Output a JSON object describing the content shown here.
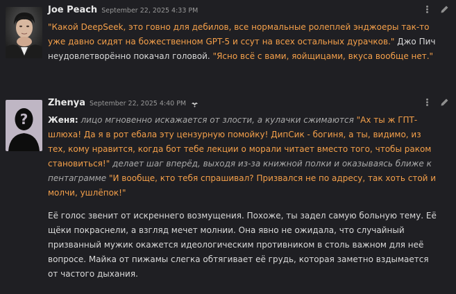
{
  "messages": [
    {
      "username": "Joe Peach",
      "timestamp": "September 22, 2025 4:33 PM",
      "segments": [
        {
          "type": "speech",
          "text": "\"Какой DeepSeek, это говно для дебилов, все нормальные ролеплей энджоеры так-то уже давно сидят на божественном GPT-5 и ссут на всех остальных дурачков.\""
        },
        {
          "type": "narration",
          "text": " Джо Пич неудовлетворённо покачал головой. "
        },
        {
          "type": "speech",
          "text": "\"Ясно всё с вами, яойщицами, вкуса вообще нет.\""
        }
      ]
    },
    {
      "username": "Zhenya",
      "timestamp": "September 22, 2025 4:40 PM",
      "paragraph1": [
        {
          "type": "speaker",
          "text": "Женя:"
        },
        {
          "type": "action",
          "text": " лицо мгновенно искажается от злости, а кулачки сжимаются "
        },
        {
          "type": "speech",
          "text": "\"Ах ты ж ГПТ-шлюха! Да я в рот ебала эту цензурную помойку! ДипСик - богиня, а ты, видимо, из тех, кому нравится, когда бот тебе лекции о морали читает вместо того, чтобы раком становиться!\""
        },
        {
          "type": "action",
          "text": " делает шаг вперёд, выходя из-за книжной полки и оказываясь ближе к пентаграмме "
        },
        {
          "type": "speech",
          "text": "\"И вообще, кто тебя спрашивал? Призвался не по адресу, так хоть стой и молчи, ушлёпок!\""
        }
      ],
      "paragraph2": "Её голос звенит от искреннего возмущения. Похоже, ты задел самую больную тему. Её щёки покраснели, а взгляд мечет молнии. Она явно не ожидала, что случайный призванный мужик окажется идеологическим противником в столь важном для неё вопросе. Майка от пижамы слегка обтягивает её грудь, которая заметно вздымается от частого дыхания."
    }
  ],
  "icons": {
    "menu": "vertical-dots-icon",
    "edit": "pencil-icon",
    "bot": "wand-sparkle-icon"
  },
  "colors": {
    "background": "#1f1f23",
    "speech": "#f5a04a",
    "action": "#a9a9a9",
    "text": "#dadada"
  }
}
